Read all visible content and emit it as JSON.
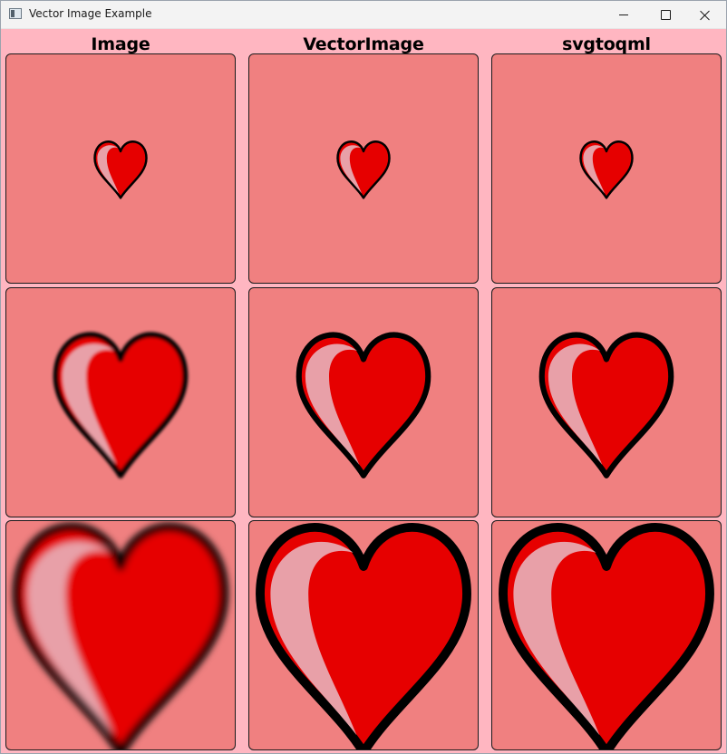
{
  "window": {
    "title": "Vector Image Example",
    "icon": "app-window-icon"
  },
  "columns": [
    {
      "label": "Image",
      "blurred": true
    },
    {
      "label": "VectorImage",
      "blurred": false
    },
    {
      "label": "svgtoqml",
      "blurred": false
    }
  ],
  "rows": [
    {
      "scale": 1.0
    },
    {
      "scale": 2.5
    },
    {
      "scale": 4.0
    }
  ],
  "colors": {
    "background": "#ffb6c1",
    "cell_fill": "#f08080",
    "heart_fill": "#e60000",
    "heart_highlight": "#e8a0a8",
    "heart_stroke": "#000000"
  },
  "icons": {
    "heart": "heart-icon",
    "minimize": "minimize-icon",
    "maximize": "maximize-icon",
    "close": "close-icon"
  }
}
